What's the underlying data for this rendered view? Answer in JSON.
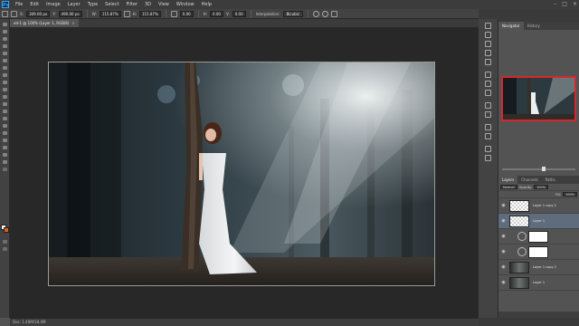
{
  "menu": {
    "logo": "Ps",
    "items": [
      "File",
      "Edit",
      "Image",
      "Layer",
      "Type",
      "Select",
      "Filter",
      "3D",
      "View",
      "Window",
      "Help"
    ],
    "window_controls": [
      "–",
      "□",
      "×"
    ]
  },
  "options_bar": {
    "x_label": "X:",
    "x_value": "309.00 px",
    "y_label": "Y:",
    "y_value": "490.00 px",
    "w_label": "W:",
    "w_value": "115.87%",
    "h_label": "H:",
    "h_value": "115.87%",
    "rotate_value": "0.00",
    "h_skew_label": "H:",
    "h_skew_value": "0.00",
    "v_skew_label": "V:",
    "v_skew_value": "0.00",
    "interpolation_label": "Interpolation:",
    "interpolation_value": "Bicubic"
  },
  "document_tab": {
    "title": "ed-1 @ 100% (Layer 1, RGB/8)",
    "close": "×"
  },
  "status_bar": {
    "text": "Doc: 1.40M/18.4M"
  },
  "navigator": {
    "tabs": [
      "Navigator",
      "History"
    ]
  },
  "layers": {
    "tabs": [
      "Layers",
      "Channels",
      "Paths"
    ],
    "blend_mode": "Normal",
    "opacity_label": "Opacity:",
    "opacity_value": "100%",
    "fill_label": "Fill:",
    "fill_value": "100%",
    "items": [
      {
        "name": "Layer 1 copy 2",
        "thumb": "checker"
      },
      {
        "name": "Layer 1",
        "thumb": "checker"
      },
      {
        "name": "",
        "thumb": "adjust"
      },
      {
        "name": "",
        "thumb": "adjust"
      },
      {
        "name": "Layer 1 copy 2",
        "thumb": "photo"
      },
      {
        "name": "Layer 1",
        "thumb": "photo"
      }
    ]
  },
  "colors": {
    "foreground": "#ffffff",
    "background": "#e05a1c",
    "navigator_box": "#d8272c"
  }
}
